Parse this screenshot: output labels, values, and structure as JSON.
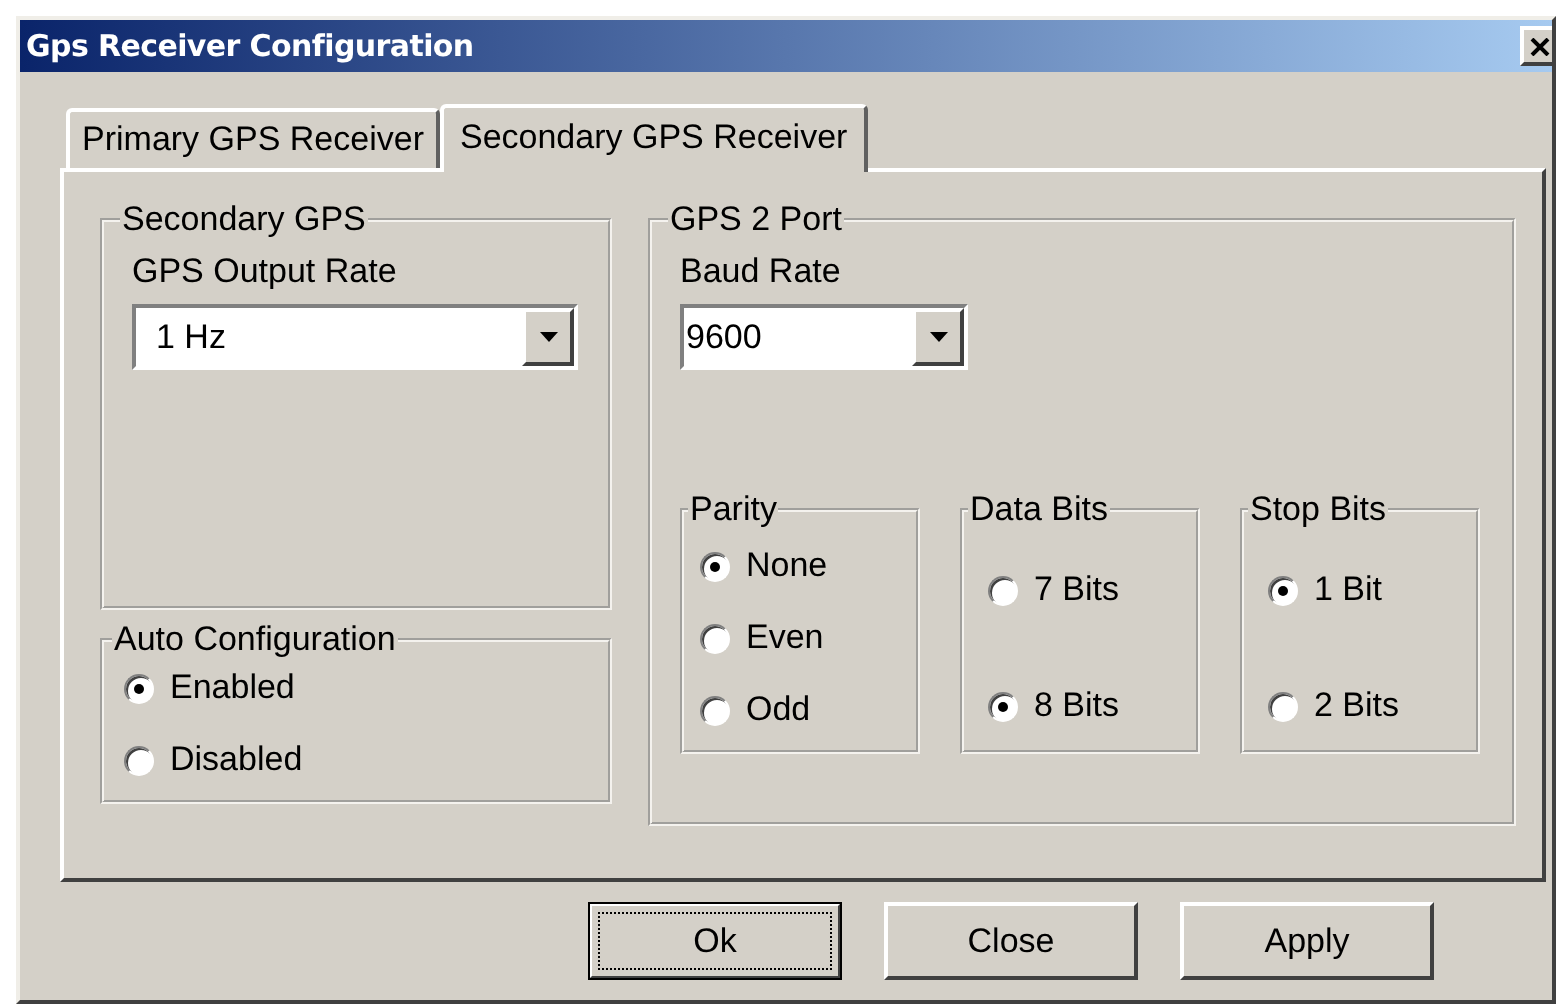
{
  "window": {
    "title": "Gps Receiver Configuration"
  },
  "tabs": [
    {
      "label": "Primary GPS Receiver",
      "selected": false
    },
    {
      "label": "Secondary GPS Receiver",
      "selected": true
    }
  ],
  "secondary_gps": {
    "title": "Secondary GPS",
    "output_rate": {
      "label": "GPS Output Rate",
      "value": "1 Hz"
    }
  },
  "auto_configuration": {
    "title": "Auto Configuration",
    "options": [
      {
        "label": "Enabled",
        "selected": true
      },
      {
        "label": "Disabled",
        "selected": false
      }
    ]
  },
  "gps2_port": {
    "title": "GPS 2 Port",
    "baud_rate": {
      "label": "Baud Rate",
      "value": "9600"
    },
    "groups": [
      {
        "title": "Parity",
        "options": [
          {
            "label": "None",
            "selected": true
          },
          {
            "label": "Even",
            "selected": false
          },
          {
            "label": "Odd",
            "selected": false
          }
        ]
      },
      {
        "title": "Data Bits",
        "options": [
          {
            "label": "7 Bits",
            "selected": false
          },
          {
            "label": "8 Bits",
            "selected": true
          }
        ]
      },
      {
        "title": "Stop Bits",
        "options": [
          {
            "label": "1 Bit",
            "selected": true
          },
          {
            "label": "2 Bits",
            "selected": false
          }
        ]
      }
    ]
  },
  "buttons": [
    {
      "label": "Ok",
      "focused": true
    },
    {
      "label": "Close",
      "focused": false
    },
    {
      "label": "Apply",
      "focused": false
    }
  ]
}
